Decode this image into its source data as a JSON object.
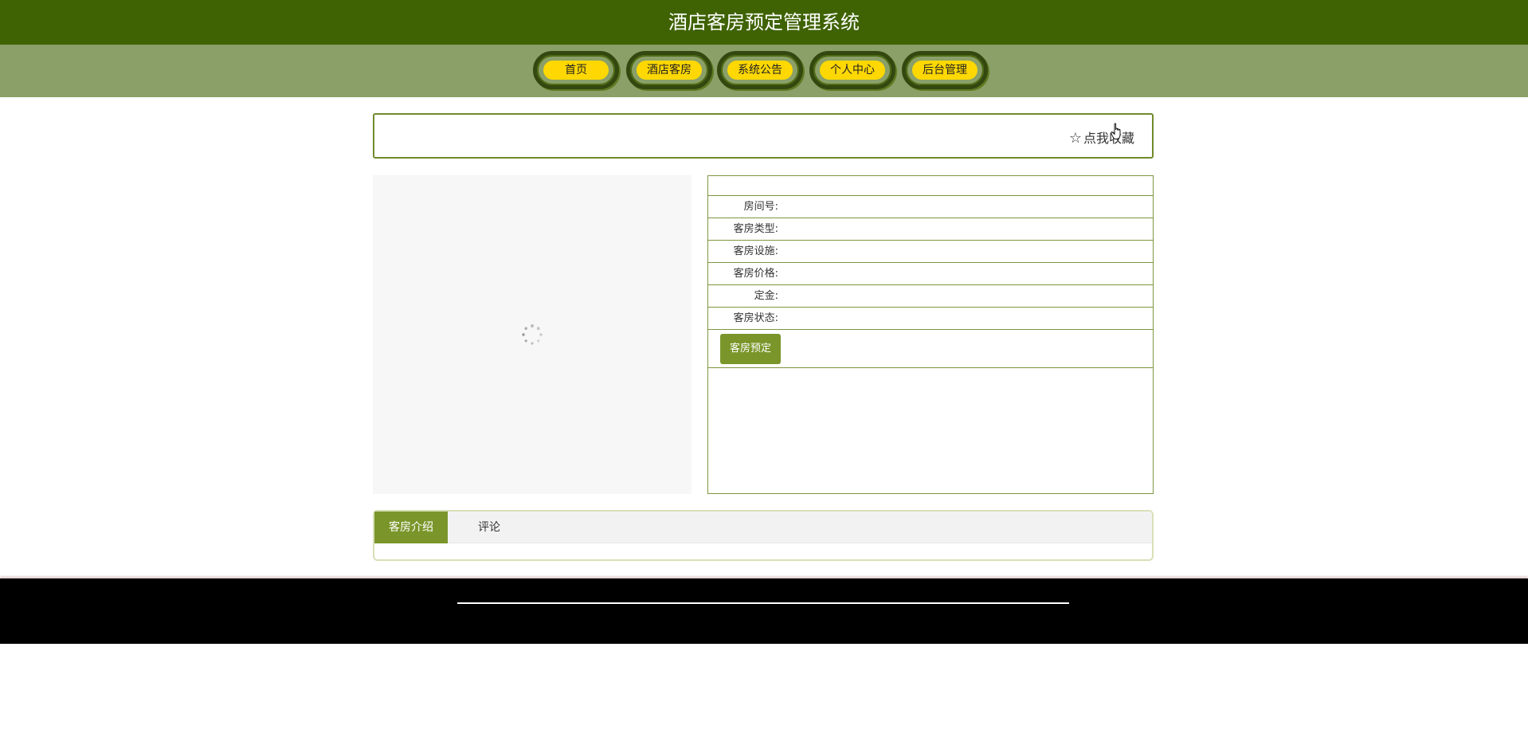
{
  "header": {
    "title": "酒店客房预定管理系统"
  },
  "nav": {
    "items": [
      {
        "label": "首页"
      },
      {
        "label": "酒店客房"
      },
      {
        "label": "系统公告"
      },
      {
        "label": "个人中心"
      },
      {
        "label": "后台管理"
      }
    ]
  },
  "collect": {
    "icon": "star-outline-icon",
    "label": "点我收藏"
  },
  "room": {
    "fields": [
      {
        "label": "房间号:",
        "value": ""
      },
      {
        "label": "客房类型:",
        "value": ""
      },
      {
        "label": "客房设施:",
        "value": ""
      },
      {
        "label": "客房价格:",
        "value": ""
      },
      {
        "label": "定金:",
        "value": ""
      },
      {
        "label": "客房状态:",
        "value": ""
      }
    ],
    "reserve_button": "客房预定"
  },
  "tabs": [
    {
      "label": "客房介绍",
      "active": true
    },
    {
      "label": "评论",
      "active": false
    }
  ],
  "colors": {
    "header_bg": "#3f6303",
    "nav_bg": "#8aa068",
    "nav_pill": "#ffd803",
    "accent": "#7a962a",
    "footer_bg": "#000000"
  }
}
